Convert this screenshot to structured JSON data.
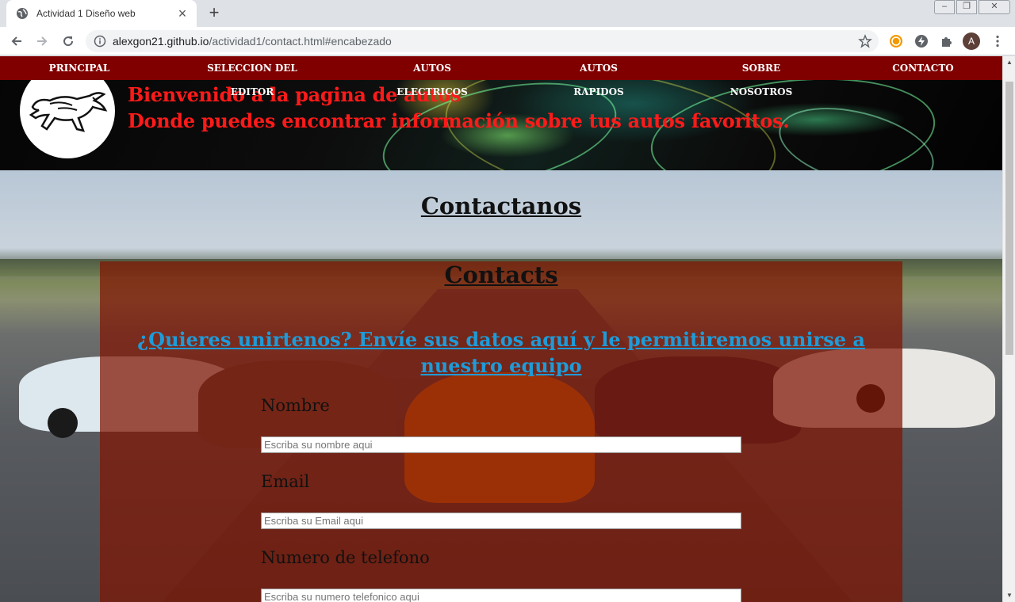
{
  "browser": {
    "tab_title": "Actividad 1 Diseño web",
    "url_host": "alexgon21.github.io",
    "url_path": "/actividad1/contact.html#encabezado",
    "avatar_letter": "A",
    "icons": [
      "globe-icon",
      "close-icon",
      "plus-icon",
      "back-icon",
      "forward-icon",
      "reload-icon",
      "info-icon",
      "star-icon",
      "extension-icon",
      "puzzle-icon",
      "menu-dots-icon"
    ]
  },
  "nav": {
    "items": [
      {
        "line1": "PRINCIPAL",
        "line2": ""
      },
      {
        "line1": "SELECCION DEL",
        "line2": "EDITOR"
      },
      {
        "line1": "AUTOS",
        "line2": "ELECTRICOS"
      },
      {
        "line1": "AUTOS",
        "line2": "RAPIDOS"
      },
      {
        "line1": "SOBRE",
        "line2": "NOSOTROS"
      },
      {
        "line1": "CONTACTO",
        "line2": ""
      }
    ],
    "bg_color": "#800000"
  },
  "header": {
    "welcome_line1": "Bienvenido a la pagina de autos",
    "welcome_line2": "Donde puedes encontrar información sobre tus autos favoritos.",
    "welcome_color": "#ff1a1a"
  },
  "main": {
    "title": "Contactanos",
    "panel_title": "Contacts",
    "join_text": "¿Quieres unirtenos? Envíe sus datos aquí y le permitiremos unirse a nuestro equipo",
    "join_color": "#1e9bd8",
    "form": {
      "name_label": "Nombre",
      "name_placeholder": "Escriba su nombre aqui",
      "email_label": "Email",
      "email_placeholder": "Escriba su Email aqui",
      "phone_label": "Numero de telefono",
      "phone_placeholder": "Escriba su numero telefonico aqui"
    }
  }
}
